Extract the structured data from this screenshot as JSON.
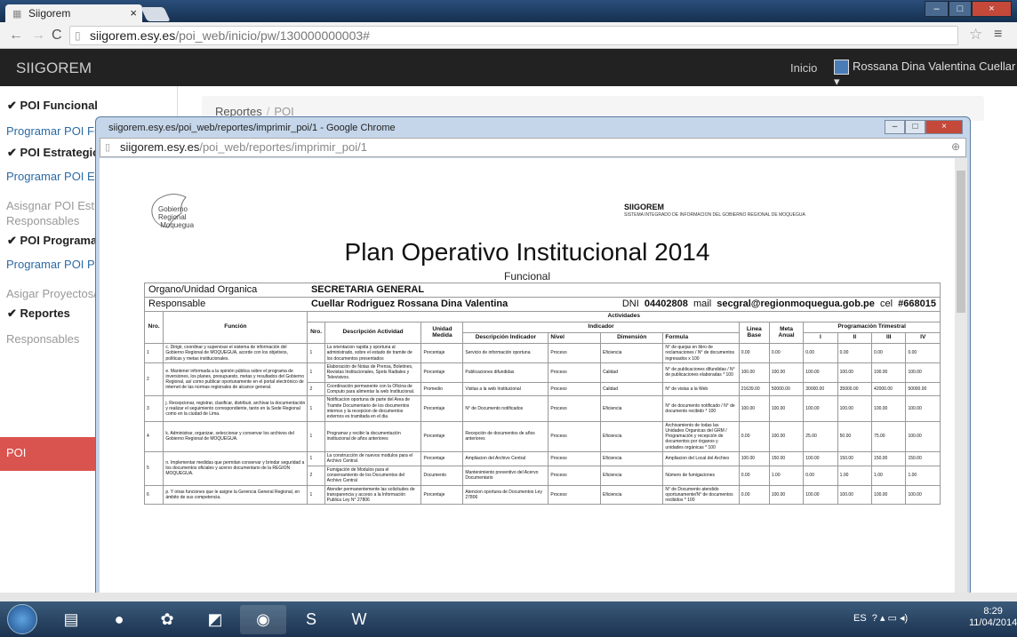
{
  "browser": {
    "tab_title": "Siigorem",
    "url_host": "siigorem.esy.es",
    "url_path": "/poi_web/inicio/pw/130000000003#"
  },
  "navbar": {
    "brand": "SIIGOREM",
    "inicio": "Inicio",
    "user": "Rossana Dina Valentina Cuellar"
  },
  "sidebar": {
    "h1": "POI Funcional",
    "i1": "Programar POI Fun",
    "h2": "POI Estrategico",
    "i2": "Programar POI Est",
    "g1a": "Asisgnar POI Estra",
    "g1b": "Responsables",
    "h3": "POI Programatic",
    "i3": "Programar POI Pro",
    "g2": "Asigar Proyectos/F",
    "h4": "Reportes",
    "g3": "Responsables",
    "active": "POI"
  },
  "breadcrumb": {
    "home": "Reportes",
    "current": "POI"
  },
  "popup": {
    "title": "siigorem.esy.es/poi_web/reportes/imprimir_poi/1 - Google Chrome",
    "url_host": "siigorem.esy.es",
    "url_path": "/poi_web/reportes/imprimir_poi/1"
  },
  "report": {
    "logo_l1": "Gobierno",
    "logo_l2": "Regional",
    "logo_l3": "Moquegua",
    "org": "SIIGOREM",
    "org_sub": "SISTEMA INTEGRADO DE INFORMACION DEL GOBIERNO REGIONAL DE MOQUEGUA",
    "title": "Plan Operativo Institucional 2014",
    "subtitle": "Funcional",
    "organo_label": "Organo/Unidad Organica",
    "organo": "SECRETARIA GENERAL",
    "resp_label": "Responsable",
    "resp": "Cuellar Rodriguez Rossana Dina Valentina",
    "dni_label": "DNI",
    "dni": "04402808",
    "mail_label": "mail",
    "mail": "secgral@regionmoquegua.gob.pe",
    "cel_label": "cel",
    "cel": "#668015",
    "headers": {
      "actividades": "Actividades",
      "nro": "Nro.",
      "funcion": "Función",
      "nro2": "Nro.",
      "desc_act": "Descripción Actividad",
      "unidad": "Unidad Medida",
      "indicador": "Indicador",
      "desc_ind": "Descripción Indicador",
      "nivel": "Nivel",
      "dimension": "Dimensión",
      "formula": "Formula",
      "linea": "Linea Base",
      "meta": "Meta Anual",
      "prog": "Programación Trimestral",
      "q1": "I",
      "q2": "II",
      "q3": "III",
      "q4": "IV"
    },
    "funciones": [
      "c. Dirigir, coordinar y supervisar el sistema de información del Gobierno Regional de MOQUEGUA, acorde con los objetivos, políticas y metas institucionales.",
      "e. Mantener informada a la opinión pública sobre el programa de inversiones, los planes, presupuesto, metas y resultados del Gobierno Regional, así como publicar oportunamente en el portal electrónico de internet de las normas regionales de alcance general.",
      "j. Recepcionar, registrar, clasificar, distribuir, archivar la documentación y realizar el seguimiento correspondiente, tanto en la Sede Regional como en la ciudad de Lima.",
      "k. Administrar, organizar, seleccionar y conservar los archivos del Gobierno Regional de MOQUEGUA.",
      "n. Implementar medidas que permitan conservar y brindar seguridad a los documentos oficiales y acervo documentario de la REGION MOQUEGUA.",
      "p. Y otras funciones que le asigne la Gerencia General Regional, en ámbito de sus competencia."
    ],
    "rows": [
      {
        "n": "1",
        "a": "La orientacion rapida y oportuna al administrado, sobre el estado de tramite de los documentos presentados",
        "u": "Porcentaje",
        "d": "Servicio de información oportuna",
        "nv": "Proceso",
        "dm": "Eficiencia",
        "f": "N° de quejas en libro de reclamaciones / N° de documentos ingresados x 100",
        "lb": "0.00",
        "ma": "0.00",
        "q1": "0.00",
        "q2": "0.00",
        "q3": "0.00",
        "q4": "0.00"
      },
      {
        "n": "1",
        "a": "Elaboración de Notas de Prensa, Boletines, Revistas Institucionales, Spots Radiales y Televisivos.",
        "u": "Porcentaje",
        "d": "Publicaciones difundidas",
        "nv": "Proceso",
        "dm": "Calidad",
        "f": "N° de publicaciones difundidas / N° de publicaciones elaboradas * 100",
        "lb": "100.00",
        "ma": "100.00",
        "q1": "100.00",
        "q2": "100.00",
        "q3": "100.00",
        "q4": "100.00"
      },
      {
        "n": "2",
        "a": "Coordinación permanente con la Oficina de Computo para alimentar la web Institucional.",
        "u": "Promedio",
        "d": "Visitas a la web Institucional",
        "nv": "Proceso",
        "dm": "Calidad",
        "f": "N° de vistas a la Web",
        "lb": "21639.00",
        "ma": "50000.00",
        "q1": "30000.00",
        "q2": "35000.00",
        "q3": "42000.00",
        "q4": "50000.00"
      },
      {
        "n": "1",
        "a": "Notificacion oportuna de parte del Area de Tramite Documentario de los documentos internos y la recepcion de documentos externos es tramitada en el dia",
        "u": "Porcentaje",
        "d": "N° de Documento notificados",
        "nv": "Proceso",
        "dm": "Eficiencia",
        "f": "N° de documento notificado / N° de documento recibido * 100",
        "lb": "100.00",
        "ma": "100.00",
        "q1": "100.00",
        "q2": "100.00",
        "q3": "100.00",
        "q4": "100.00"
      },
      {
        "n": "1",
        "a": "Programar y recibir la documentación institucional de años anteriores",
        "u": "Porcentaje",
        "d": "Recepción de documentos de años anteriores",
        "nv": "Proceso",
        "dm": "Eficiencia",
        "f": "Archivamiento de todas las Unidades Organicas del GRM / Programación y recepción de documentos por órganos y unidades orgánicas * 100",
        "lb": "0.00",
        "ma": "100.00",
        "q1": "25.00",
        "q2": "50.00",
        "q3": "75.00",
        "q4": "100.00"
      },
      {
        "n": "1",
        "a": "La construcción de nuevos modulos para el Archivo Central.",
        "u": "Porcentaje",
        "d": "Ampliacion del Archivo Central",
        "nv": "Proceso",
        "dm": "Eficiencia",
        "f": "Ampliacion del Local del Archivo",
        "lb": "100.00",
        "ma": "150.00",
        "q1": "100.00",
        "q2": "150.00",
        "q3": "150.00",
        "q4": "150.00"
      },
      {
        "n": "2",
        "a": "Fumigación de Modulos para el conservamiento de los Documentos del Archivo Central",
        "u": "Documento",
        "d": "Mantenimiento preventivo del Acervo Documentario",
        "nv": "Proceso",
        "dm": "Eficiencia",
        "f": "Número de fumigaciones",
        "lb": "0.00",
        "ma": "1.00",
        "q1": "0.00",
        "q2": "1.00",
        "q3": "1.00",
        "q4": "1.00"
      },
      {
        "n": "1",
        "a": "Atender permanentemente las solicitudes de transparencia y acceso a la Información Publica Ley N° 27806",
        "u": "Porcentaje",
        "d": "Atencion oportuna de Documentos Ley 27806",
        "nv": "Proceso",
        "dm": "Eficiencia",
        "f": "N° de Documento atendido oportunamente/N° de documentos recibidos * 100",
        "lb": "0.00",
        "ma": "100.00",
        "q1": "100.00",
        "q2": "100.00",
        "q3": "100.00",
        "q4": "100.00"
      }
    ]
  },
  "taskbar": {
    "lang": "ES",
    "time": "8:29",
    "date": "11/04/2014"
  }
}
